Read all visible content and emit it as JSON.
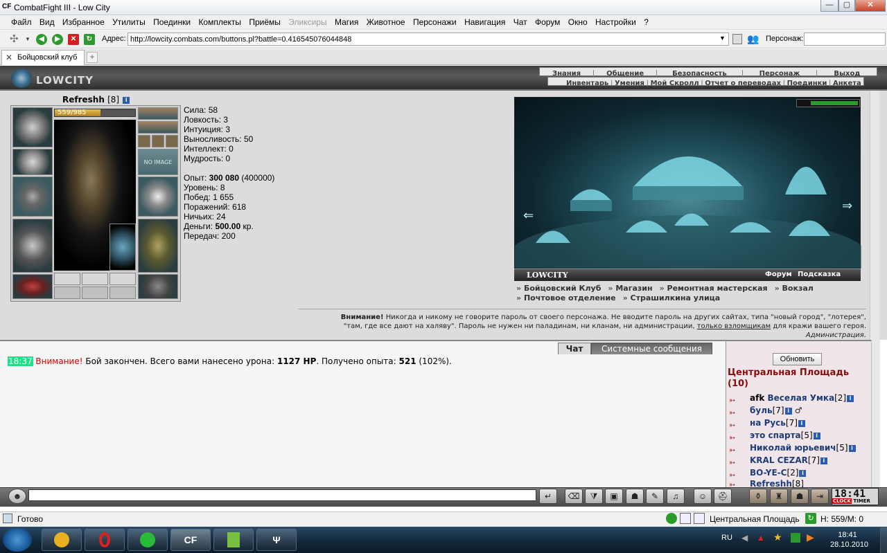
{
  "window": {
    "app_icon": "CF",
    "title": "CombatFight III - Low City",
    "minimize": "—",
    "maximize": "▢",
    "close": "✕"
  },
  "menu": [
    "Файл",
    "Вид",
    "Избранное",
    "Утилиты",
    "Поединки",
    "Комплекты",
    "Приёмы",
    "Эликсиры",
    "Магия",
    "Животное",
    "Персонажи",
    "Навигация",
    "Чат",
    "Форум",
    "Окно",
    "Настройки",
    "?"
  ],
  "address": {
    "label": "Адрес:",
    "value": "http://lowcity.combats.com/buttons.pl?battle=0.416545076044848",
    "persona_label": "Персонаж:",
    "persona_value": ""
  },
  "tab": {
    "label": "Бойцовский клуб",
    "add": "+"
  },
  "header": {
    "logo": "LOWCITY",
    "nav_top": [
      "Знания",
      "Общение",
      "Безопасность",
      "Персонаж",
      "Выход"
    ],
    "nav_sub": [
      "Инвентарь",
      "Умения",
      "Мой Скролл",
      "Отчет о переводах",
      "Поединки",
      "Анкета"
    ]
  },
  "character": {
    "name": "Refreshh",
    "level": "[8]",
    "hp": "559/985",
    "hp_fraction": 0.5675,
    "no_image": "NO IMAGE",
    "stats": [
      {
        "label": "Сила:",
        "value": "58"
      },
      {
        "label": "Ловкость:",
        "value": "3"
      },
      {
        "label": "Интуиция:",
        "value": "3"
      },
      {
        "label": "Выносливость:",
        "value": "50"
      },
      {
        "label": "Интеллект:",
        "value": "0"
      },
      {
        "label": "Мудрость:",
        "value": "0"
      }
    ],
    "exp_label": "Опыт:",
    "exp_value": "300 080",
    "exp_next": "(400000)",
    "level_label": "Уровень:",
    "level_value": "8",
    "wins_label": "Побед:",
    "wins_value": "1 655",
    "losses_label": "Поражений:",
    "losses_value": "618",
    "draws_label": "Ничьих:",
    "draws_value": "24",
    "money_label": "Деньги:",
    "money_value": "500.00",
    "money_unit": "кр.",
    "transfers_label": "Передач:",
    "transfers_value": "200"
  },
  "city": {
    "name": "LOWCITY",
    "forum": "Форум",
    "help": "Подсказка",
    "links": [
      "Бойцовский Клуб",
      "Магазин",
      "Ремонтная мастерская",
      "Вокзал",
      "Почтовое отделение",
      "Страшилкина улица"
    ]
  },
  "warning": {
    "bold": "Внимание!",
    "text1": " Никогда и никому не говорите пароль от своего персонажа. Не вводите пароль на других сайтах, типа \"новый город\", \"лотерея\",",
    "text2": "\"там, где все дают на халяву\". Пароль не нужен ни паладинам, ни кланам, ни администрации, ",
    "link": "только взломщикам",
    "text3": " для кражи вашего героя.",
    "admin": "Администрация."
  },
  "chat": {
    "tab_chat": "Чат",
    "tab_system": "Системные сообщения",
    "time": "18:37",
    "warn": "Внимание!",
    "msg1": " Бой закончен. Всего вами нанесено урона: ",
    "damage": "1127 HP",
    "msg2": ". Получено опыта: ",
    "exp": "521",
    "msg3": " (102%)."
  },
  "online": {
    "refresh": "Обновить",
    "room": "Центральная Площадь",
    "count": "(10)",
    "users": [
      {
        "prefix": "afk ",
        "name": "Веселая Умка",
        "level": "[2]"
      },
      {
        "prefix": "",
        "name": "буль",
        "level": "[7]"
      },
      {
        "prefix": "",
        "name": "на Русь",
        "level": "[7]"
      },
      {
        "prefix": "",
        "name": "это спарта",
        "level": "[5]"
      },
      {
        "prefix": "",
        "name": "Николай юрьевич",
        "level": "[5]"
      },
      {
        "prefix": "",
        "name": "KRAL CEZAR",
        "level": "[7]"
      },
      {
        "prefix": "",
        "name": "BO-YE-C",
        "level": "[2]"
      },
      {
        "prefix": "",
        "name": "Refreshh",
        "level": "[8]"
      }
    ]
  },
  "clock": {
    "time": "18:41",
    "label_a": "CLOCK",
    "label_b": "TIMER"
  },
  "statusbar": {
    "ready": "Готово",
    "location": "Центральная Площадь",
    "hp": "Н: 559/М: 0"
  },
  "taskbar": {
    "lang": "RU",
    "time": "18:41",
    "date": "28.10.2010",
    "task_cf": "CF"
  }
}
